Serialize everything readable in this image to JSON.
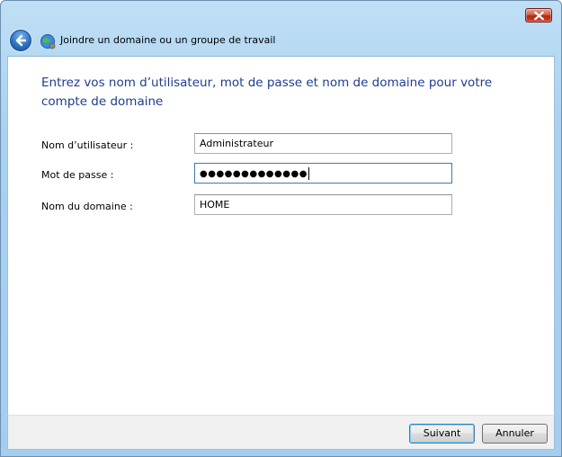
{
  "window": {
    "title": "Joindre un domaine ou un groupe de travail",
    "close_icon": "close-icon",
    "back_icon": "back-arrow-icon",
    "title_icon": "network-globe-icon"
  },
  "main": {
    "instruction": "Entrez vos nom d’utilisateur, mot de passe et nom de domaine pour votre compte de domaine",
    "fields": {
      "username": {
        "label": "Nom d’utilisateur :",
        "value": "Administrateur"
      },
      "password": {
        "label": "Mot de passe :",
        "value": "●●●●●●●●●●●●●"
      },
      "domain": {
        "label": "Nom du domaine :",
        "value": "HOME"
      }
    }
  },
  "footer": {
    "next_label": "Suivant",
    "cancel_label": "Annuler"
  },
  "colors": {
    "instruction_text": "#1e3d8f",
    "window_frame": "#a9d0ef",
    "close_button": "#c9442b"
  }
}
